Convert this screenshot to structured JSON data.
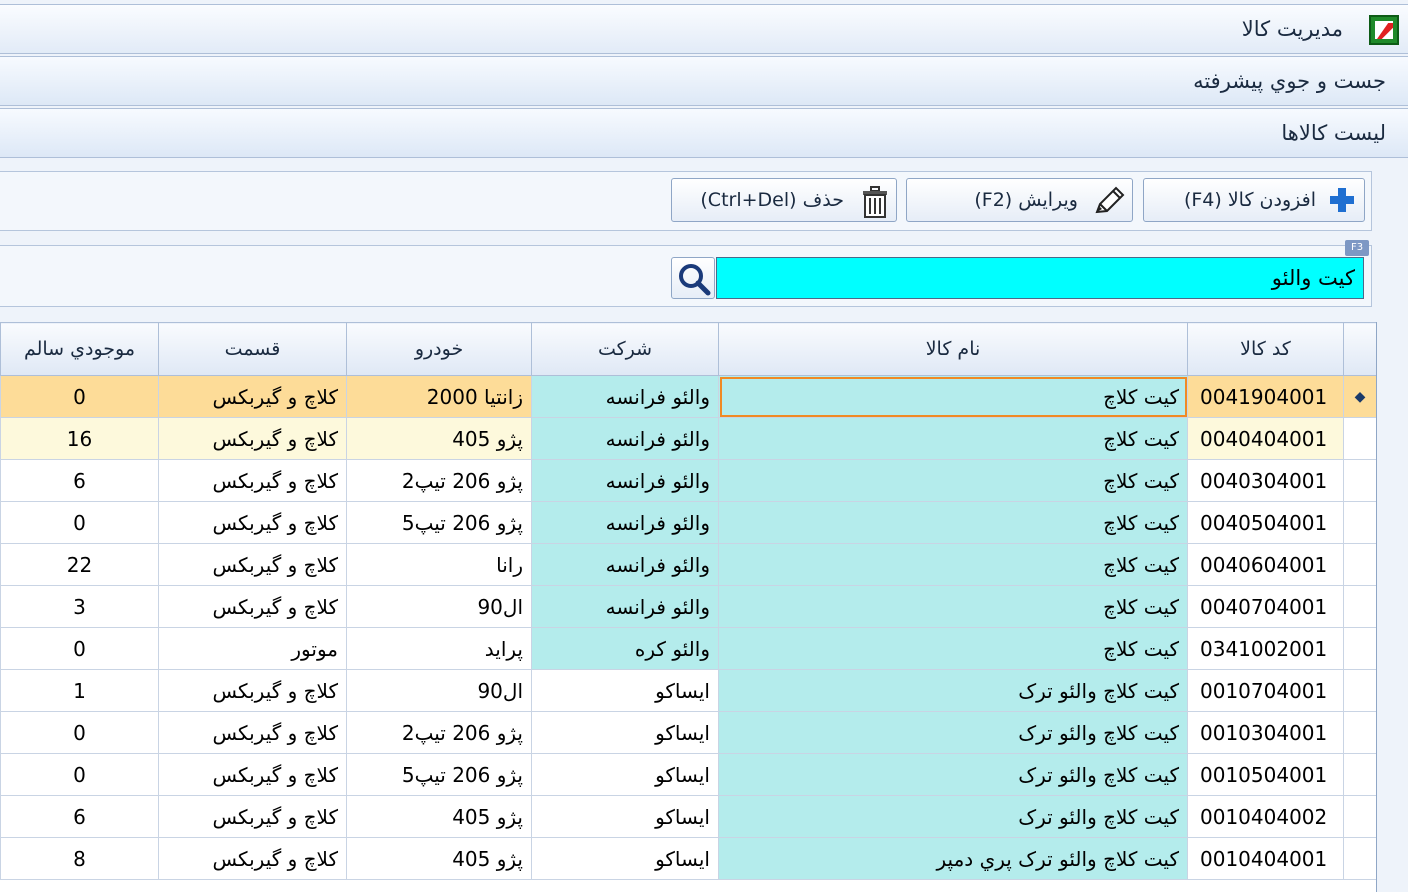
{
  "window": {
    "title": "مديريت کالا",
    "icon": "app-logo-icon"
  },
  "panels": {
    "advanced_search": "جست و جوي پيشرفته",
    "product_list": "ليست کالاها"
  },
  "toolbar": {
    "add_label": "افزودن کالا (F4)",
    "add_icon": "plus-icon",
    "edit_label": "ويرايش (F2)",
    "edit_icon": "pencil-icon",
    "delete_label": "حذف (Ctrl+Del)",
    "delete_icon": "trash-icon"
  },
  "search": {
    "value": "کيت والئو",
    "shortcut_badge": "F3",
    "button_icon": "search-icon",
    "highlight_color": "#00ffff"
  },
  "grid": {
    "columns": [
      "کد کالا",
      "نام کالا",
      "شرکت",
      "خودرو",
      "قسمت",
      "موجودي سالم"
    ],
    "selected_indicator": "◆",
    "rows": [
      {
        "code": "0041904001",
        "name": "کيت کلاچ",
        "company": "والئو فرانسه",
        "car": "زانتيا 2000",
        "section": "کلاچ و گيربکس",
        "stock": "0"
      },
      {
        "code": "0040404001",
        "name": "کيت کلاچ",
        "company": "والئو فرانسه",
        "car": "پژو 405",
        "section": "کلاچ و گيربکس",
        "stock": "16"
      },
      {
        "code": "0040304001",
        "name": "کيت کلاچ",
        "company": "والئو فرانسه",
        "car": "پژو 206 تيپ2",
        "section": "کلاچ و گيربکس",
        "stock": "6"
      },
      {
        "code": "0040504001",
        "name": "کيت کلاچ",
        "company": "والئو فرانسه",
        "car": "پژو 206 تيپ5",
        "section": "کلاچ و گيربکس",
        "stock": "0"
      },
      {
        "code": "0040604001",
        "name": "کيت کلاچ",
        "company": "والئو فرانسه",
        "car": "رانا",
        "section": "کلاچ و گيربکس",
        "stock": "22"
      },
      {
        "code": "0040704001",
        "name": "کيت کلاچ",
        "company": "والئو فرانسه",
        "car": "ال90",
        "section": "کلاچ و گيربکس",
        "stock": "3"
      },
      {
        "code": "0341002001",
        "name": "کيت کلاچ",
        "company": "والئو کره",
        "car": "پرايد",
        "section": "موتور",
        "stock": "0"
      },
      {
        "code": "0010704001",
        "name": "کيت کلاچ والئو ترک",
        "company": "ايساکو",
        "car": "ال90",
        "section": "کلاچ و گيربکس",
        "stock": "1"
      },
      {
        "code": "0010304001",
        "name": "کيت کلاچ والئو ترک",
        "company": "ايساکو",
        "car": "پژو 206 تيپ2",
        "section": "کلاچ و گيربکس",
        "stock": "0"
      },
      {
        "code": "0010504001",
        "name": "کيت کلاچ والئو ترک",
        "company": "ايساکو",
        "car": "پژو 206 تيپ5",
        "section": "کلاچ و گيربکس",
        "stock": "0"
      },
      {
        "code": "0010404002",
        "name": "کيت کلاچ والئو ترک",
        "company": "ايساکو",
        "car": "پژو 405",
        "section": "کلاچ و گيربکس",
        "stock": "6"
      },
      {
        "code": "0010404001",
        "name": "کيت کلاچ والئو ترک پري دمپر",
        "company": "ايساکو",
        "car": "پژو 405",
        "section": "کلاچ و گيربکس",
        "stock": "8"
      }
    ]
  },
  "colors": {
    "selected_row": "#fddc98",
    "cyan_cell": "#b4ecec",
    "focus_border": "#f08a24",
    "alt_row": "#fdf9dc"
  }
}
